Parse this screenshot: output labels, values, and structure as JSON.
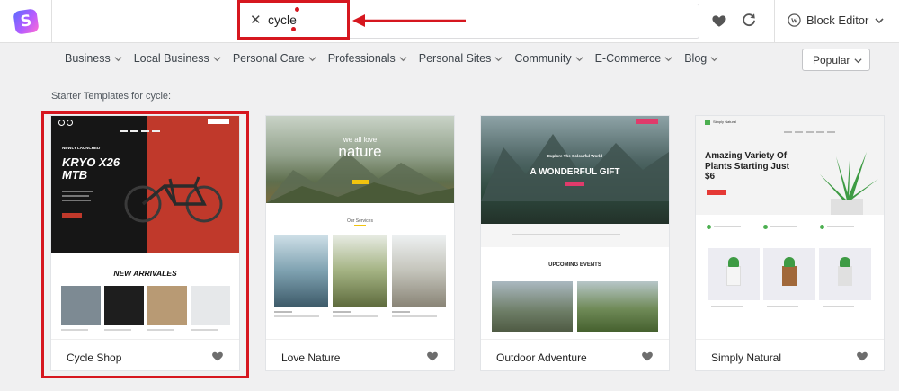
{
  "topbar": {
    "search_query": "cycle",
    "clear_icon": "close-icon",
    "favorites_icon": "heart-icon",
    "refresh_icon": "refresh-icon",
    "editor_label": "Block Editor"
  },
  "categories": [
    {
      "label": "Business"
    },
    {
      "label": "Local Business"
    },
    {
      "label": "Personal Care"
    },
    {
      "label": "Professionals"
    },
    {
      "label": "Personal Sites"
    },
    {
      "label": "Community"
    },
    {
      "label": "E-Commerce"
    },
    {
      "label": "Blog"
    }
  ],
  "sort": {
    "selected": "Popular"
  },
  "results_heading": "Starter Templates for cycle:",
  "templates": [
    {
      "name": "Cycle Shop",
      "preview": {
        "kicker": "NEWLY LAUNCHED",
        "headline_1": "KRYO X26",
        "headline_2": "MTB",
        "section_title": "NEW ARRIVALES"
      }
    },
    {
      "name": "Love Nature",
      "preview": {
        "hero_small": "we all love",
        "hero_big": "nature",
        "section_title": "Our Services"
      }
    },
    {
      "name": "Outdoor Adventure",
      "preview": {
        "hero_small": "Explore The Colourful World",
        "hero_big": "A WONDERFUL GIFT",
        "section_title": "UPCOMING EVENTS"
      }
    },
    {
      "name": "Simply Natural",
      "preview": {
        "brand": "Simply Natural",
        "hero_title": "Amazing Variety Of Plants Starting Just $6"
      }
    }
  ],
  "colors": {
    "highlight": "#d6171f",
    "cycle_red": "#c0392b",
    "nature_yellow": "#f1c40f",
    "plants_green": "#4caf50"
  }
}
